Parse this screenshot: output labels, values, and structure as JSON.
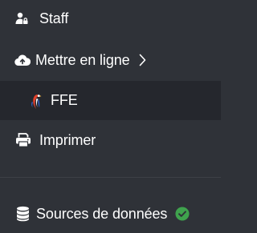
{
  "menu": {
    "items": [
      {
        "label": "Staff",
        "icon": "user-lock-icon"
      },
      {
        "label": "Mettre en ligne",
        "icon": "cloud-upload-icon",
        "trailing_icon": "chevron-right-icon"
      },
      {
        "label": "FFE",
        "icon": "ffe-rooster-logo-icon"
      },
      {
        "label": "Imprimer",
        "icon": "printer-icon"
      },
      {
        "label": "Sources de données",
        "icon": "database-icon",
        "trailing_icon": "check-circle-icon",
        "status_color": "#3fa34d"
      }
    ]
  },
  "colors": {
    "background": "#2f3238",
    "selected_background": "#25272d",
    "text": "#ffffff",
    "status_ok": "#3fa34d"
  }
}
